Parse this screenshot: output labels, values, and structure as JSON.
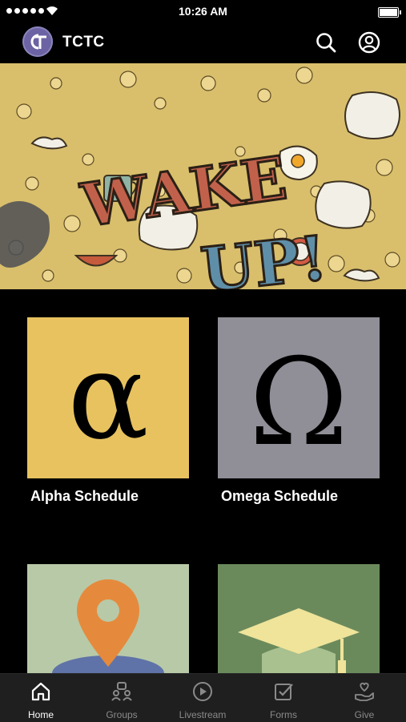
{
  "status_bar": {
    "time": "10:26 AM"
  },
  "app_bar": {
    "title": "TCTC"
  },
  "hero": {
    "headline_line1": "WAKE",
    "headline_line2": "UP!"
  },
  "tiles": [
    {
      "label": "Alpha Schedule",
      "symbol": "α",
      "bg": "#e7c25f"
    },
    {
      "label": "Omega Schedule",
      "symbol": "Ω",
      "bg": "#908e96"
    },
    {
      "label": "",
      "symbol": "location-pin-icon",
      "bg": "#b8c9a8"
    },
    {
      "label": "",
      "symbol": "graduation-cap-icon",
      "bg": "#6b8a5c"
    }
  ],
  "tab_bar": [
    {
      "label": "Home",
      "icon": "home-icon",
      "active": true
    },
    {
      "label": "Groups",
      "icon": "groups-icon"
    },
    {
      "label": "Livestream",
      "icon": "play-icon"
    },
    {
      "label": "Forms",
      "icon": "checkbox-icon"
    },
    {
      "label": "Give",
      "icon": "heart-hand-icon"
    }
  ],
  "colors": {
    "background": "#000000",
    "tab_bar": "#1f1f1f",
    "active_tab": "#ffffff",
    "inactive_tab": "#8a8a8a"
  }
}
